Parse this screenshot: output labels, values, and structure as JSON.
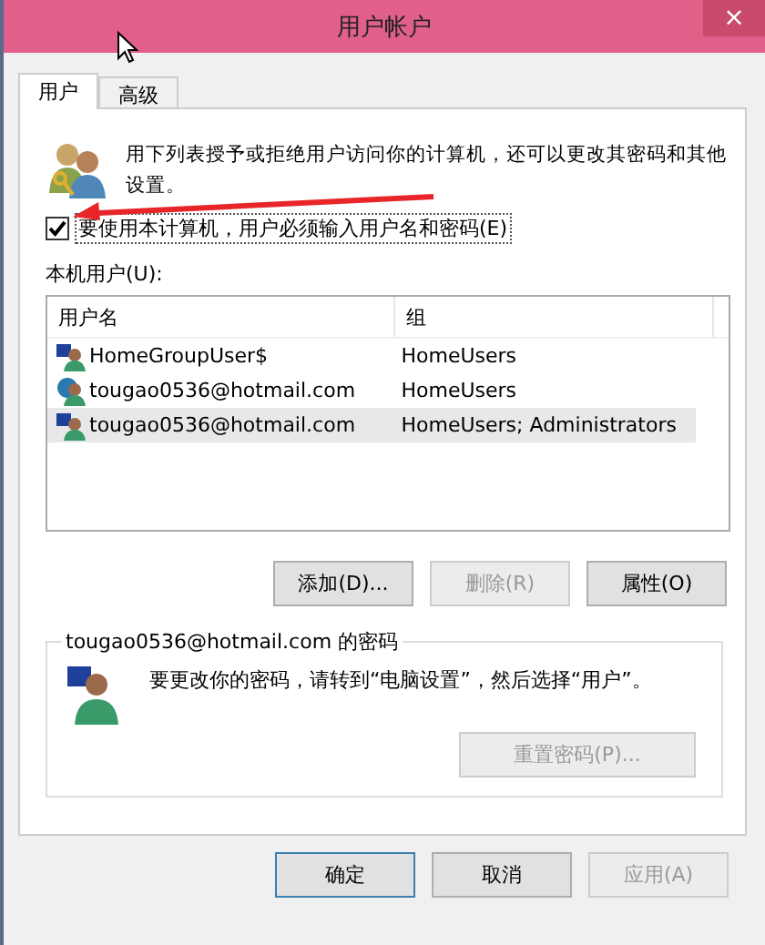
{
  "window": {
    "title": "用户帐户",
    "close": "×"
  },
  "tabs": [
    {
      "label": "用户",
      "selected": true
    },
    {
      "label": "高级",
      "selected": false
    }
  ],
  "intro": "用下列表授予或拒绝用户访问你的计算机，还可以更改其密码和其他设置。",
  "require_password": {
    "label": "要使用本计算机，用户必须输入用户名和密码(E)",
    "checked": true
  },
  "users_label": "本机用户(U):",
  "table": {
    "columns": [
      "用户名",
      "组"
    ],
    "rows": [
      {
        "kind": "local",
        "name": "HomeGroupUser$",
        "group": "HomeUsers",
        "selected": false
      },
      {
        "kind": "online",
        "name": "tougao0536@hotmail.com",
        "group": "HomeUsers",
        "selected": false
      },
      {
        "kind": "local",
        "name": "tougao0536@hotmail.com",
        "group": "HomeUsers; Administrators",
        "selected": true
      }
    ]
  },
  "user_buttons": [
    {
      "label": "添加(D)...",
      "disabled": false
    },
    {
      "label": "删除(R)",
      "disabled": true
    },
    {
      "label": "属性(O)",
      "disabled": false
    }
  ],
  "password_group": {
    "title": "tougao0536@hotmail.com 的密码",
    "message": "要更改你的密码，请转到“电脑设置”，然后选择“用户”。",
    "button": {
      "label": "重置密码(P)...",
      "disabled": true
    }
  },
  "dialog_buttons": [
    {
      "label": "确定",
      "disabled": false,
      "default": true
    },
    {
      "label": "取消",
      "disabled": false,
      "default": false
    },
    {
      "label": "应用(A)",
      "disabled": true,
      "default": false
    }
  ]
}
